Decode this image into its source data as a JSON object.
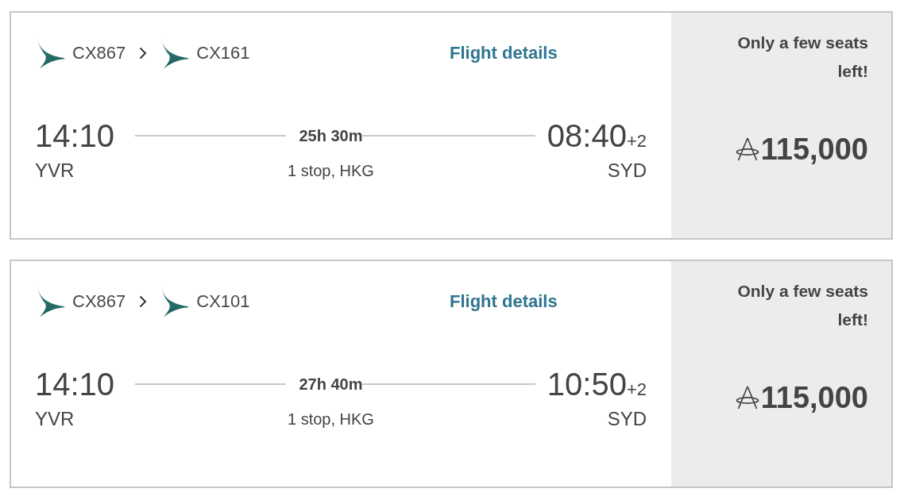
{
  "flights": [
    {
      "segments": [
        {
          "flight_number": "CX867"
        },
        {
          "flight_number": "CX161"
        }
      ],
      "details_link": "Flight details",
      "departure": {
        "time": "14:10",
        "airport": "YVR"
      },
      "duration": "25h 30m",
      "stops": "1 stop, HKG",
      "arrival": {
        "time": "08:40",
        "day_offset": "+2",
        "airport": "SYD"
      },
      "availability": "Only a few seats left!",
      "price": "115,000"
    },
    {
      "segments": [
        {
          "flight_number": "CX867"
        },
        {
          "flight_number": "CX101"
        }
      ],
      "details_link": "Flight details",
      "departure": {
        "time": "14:10",
        "airport": "YVR"
      },
      "duration": "27h 40m",
      "stops": "1 stop, HKG",
      "arrival": {
        "time": "10:50",
        "day_offset": "+2",
        "airport": "SYD"
      },
      "availability": "Only a few seats left!",
      "price": "115,000"
    }
  ]
}
